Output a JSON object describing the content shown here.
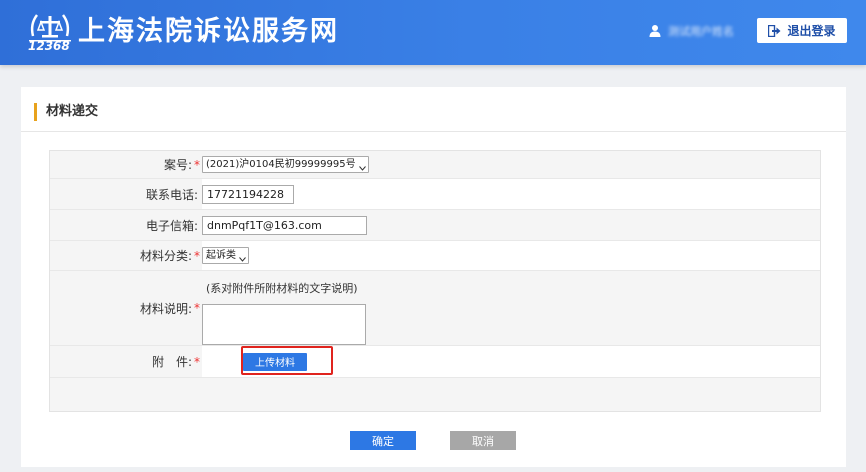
{
  "header": {
    "logo_text": "12368",
    "site_title": "上海法院诉讼服务网",
    "user_name": "测试用户姓名",
    "logout_label": "退出登录",
    "background_color": "#3a80e6"
  },
  "page": {
    "section_title": "材料递交",
    "accent_color": "#e8a21c"
  },
  "form": {
    "case_no": {
      "label": "案号:",
      "required_mark": "*",
      "value": "(2021)沪0104民初99999995号"
    },
    "phone": {
      "label": "联系电话:",
      "value": "17721194228"
    },
    "email": {
      "label": "电子信箱:",
      "value": "dnmPqf1T@163.com"
    },
    "category": {
      "label": "材料分类:",
      "required_mark": "*",
      "value": "起诉类"
    },
    "description": {
      "label": "材料说明:",
      "required_mark": "*",
      "hint": "(系对附件所附材料的文字说明)",
      "value": ""
    },
    "attachment": {
      "label": "附　件:",
      "required_mark": "*",
      "upload_label": "上传材料"
    }
  },
  "actions": {
    "confirm_label": "确定",
    "cancel_label": "取消",
    "confirm_color": "#2d78e4",
    "cancel_color": "#a7a7a7"
  },
  "annotation": {
    "highlight_color": "#e0241e"
  }
}
